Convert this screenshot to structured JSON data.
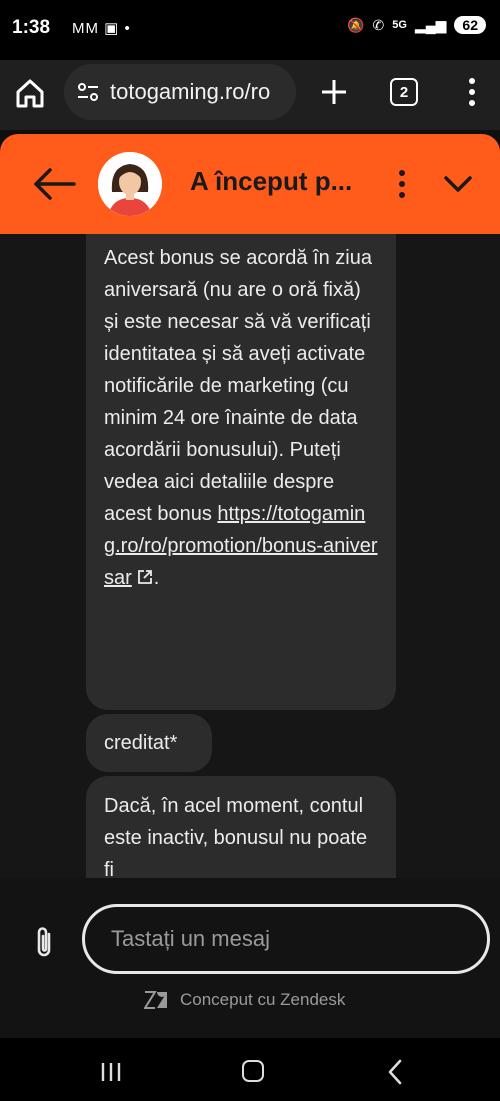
{
  "status": {
    "time": "1:38",
    "left_icons": [
      "gmail-icon",
      "gmail-icon",
      "briefcase-icon",
      "dot-icon"
    ],
    "network": "5G",
    "battery": "62"
  },
  "browser": {
    "url": "totogaming.ro/ro",
    "tab_count": "2"
  },
  "chat": {
    "title": "A început p...",
    "accent": "#ff5c1c",
    "messages": [
      {
        "text": "Acest bonus se acordă în ziua aniversară (nu are o oră fixă) și este necesar să vă verificați identitatea și să aveți activate notificările de marketing (cu minim 24 ore înainte de data acordării bonusului). Puteți vedea aici detaliile despre acest bonus ",
        "link": "https://totogaming.ro/ro/promotion/bonus-aniversar",
        "suffix": "."
      },
      {
        "text": "creditat*"
      },
      {
        "text": "Dacă, în acel moment, contul este inactiv, bonusul nu poate fi"
      }
    ]
  },
  "composer": {
    "placeholder": "Tastați un mesaj",
    "footer": "Conceput cu Zendesk"
  }
}
